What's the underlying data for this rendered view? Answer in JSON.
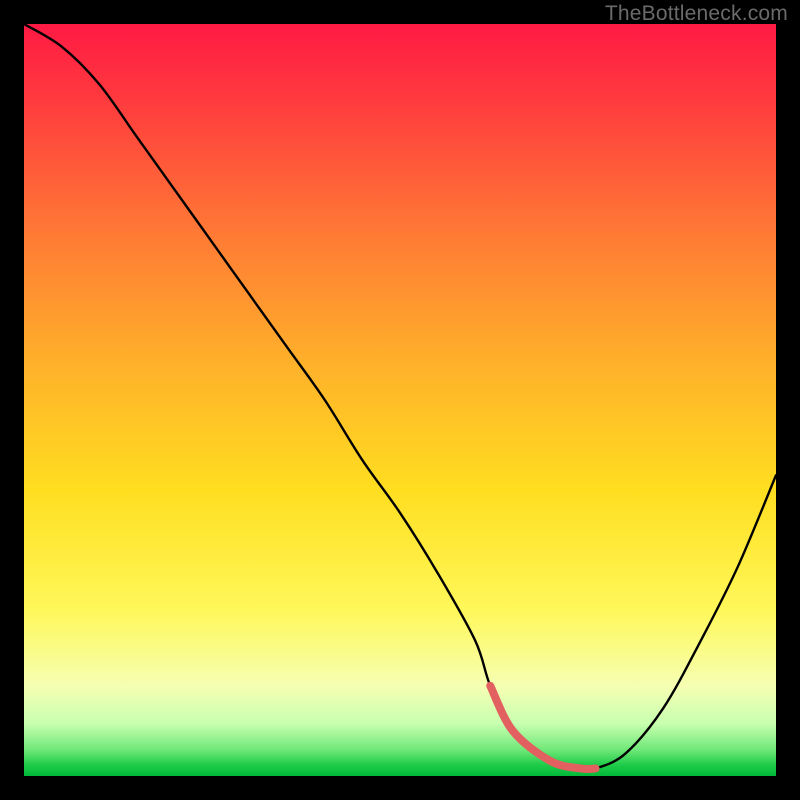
{
  "attribution": "TheBottleneck.com",
  "chart_data": {
    "type": "line",
    "title": "",
    "xlabel": "",
    "ylabel": "",
    "xlim": [
      0,
      100
    ],
    "ylim": [
      0,
      100
    ],
    "gradient_top_color": "#ff1a44",
    "gradient_mid_color": "#ffd400",
    "gradient_bottom_green": "#00c83c",
    "line_color": "#000000",
    "highlight_color": "#e26060",
    "series": [
      {
        "name": "bottleneck-curve",
        "x": [
          0,
          5,
          10,
          15,
          20,
          25,
          30,
          35,
          40,
          45,
          50,
          55,
          60,
          62,
          65,
          70,
          74,
          76,
          80,
          85,
          90,
          95,
          100
        ],
        "values": [
          100,
          97,
          92,
          85,
          78,
          71,
          64,
          57,
          50,
          42,
          35,
          27,
          18,
          12,
          6,
          2,
          1,
          1,
          3,
          9,
          18,
          28,
          40
        ]
      }
    ],
    "highlight_range": {
      "x_start": 62,
      "x_end": 76
    }
  }
}
